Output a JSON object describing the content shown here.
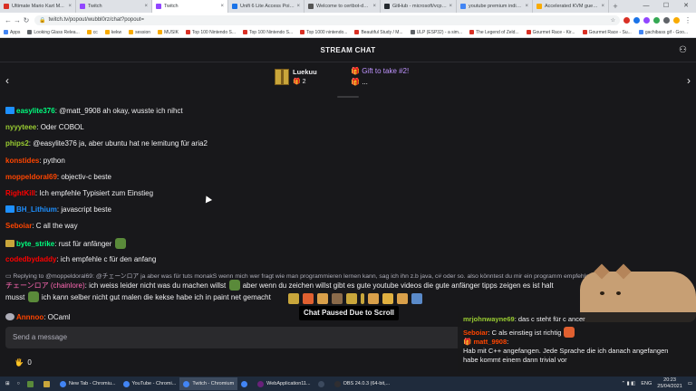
{
  "browser": {
    "tabs": [
      {
        "label": "Ultimate Mario Kart M...",
        "color": "#d93025",
        "active": false
      },
      {
        "label": "Twitch",
        "color": "#9146ff",
        "active": false
      },
      {
        "label": "Twitch",
        "color": "#9146ff",
        "active": true
      },
      {
        "label": "Unifi 6 Lite Access Point -...",
        "color": "#1a73e8",
        "active": false
      },
      {
        "label": "Welcome to certbot-dns-cl...",
        "color": "#555555",
        "active": false
      },
      {
        "label": "GitHub - microsoft/vcpkg: C...",
        "color": "#24292e",
        "active": false
      },
      {
        "label": "youtube premium india - G...",
        "color": "#4285f4",
        "active": false
      },
      {
        "label": "Accelerated KVM guests o...",
        "color": "#f9ab00",
        "active": false
      }
    ],
    "url": "twitch.tv/popout/wubbl0rz/chat?popout=",
    "bookmarks": [
      {
        "label": "Apps",
        "color": "#4285f4"
      },
      {
        "label": "Looking Glass Relea...",
        "color": "#5f6368"
      },
      {
        "label": "cc",
        "color": "#f9ab00"
      },
      {
        "label": "kekw",
        "color": "#f9ab00"
      },
      {
        "label": "session",
        "color": "#f9ab00"
      },
      {
        "label": "MUSIK",
        "color": "#f9ab00"
      },
      {
        "label": "Top 100 Nintendo S...",
        "color": "#d93025"
      },
      {
        "label": "Top 100 Nintendo S...",
        "color": "#d93025"
      },
      {
        "label": "Top 1000 nintendo...",
        "color": "#d93025"
      },
      {
        "label": "Beautiful Study / M...",
        "color": "#d93025"
      },
      {
        "label": "ULP (ESP32) - a sim...",
        "color": "#5f6368"
      },
      {
        "label": "The Legend of Zeld...",
        "color": "#d93025"
      },
      {
        "label": "Gourmet Race - Kir...",
        "color": "#d93025"
      },
      {
        "label": "Gourmet Race - Su...",
        "color": "#d93025"
      },
      {
        "label": "gachibass gif - Goo...",
        "color": "#4285f4"
      }
    ]
  },
  "header": {
    "title": "STREAM CHAT"
  },
  "gifts": {
    "left_name": "Luekuu",
    "left_count": "2",
    "right_title": "Gift to take #2!",
    "right_detail": "..."
  },
  "messages": [
    {
      "user": "easylite376",
      "color": "#00ff7f",
      "badge": "#1e90ff",
      "text": ": @matt_9908 ah okay, wusste ich nihct"
    },
    {
      "user": "nyyyteee",
      "color": "#9acd32",
      "badge": "",
      "text": ": Oder COBOL"
    },
    {
      "user": "phips2",
      "color": "#9acd32",
      "badge": "",
      "text": ": @easylite376 ja, aber ubuntu hat ne lemitung für aria2"
    },
    {
      "user": "konstides",
      "color": "#ff4500",
      "badge": "",
      "text": ": python"
    },
    {
      "user": "moppeldoral69",
      "color": "#ff4500",
      "badge": "",
      "text": ": objectiv-c beste"
    },
    {
      "user": "RightKill",
      "color": "#ff0000",
      "badge": "",
      "text": ": Ich empfehle Typisiert zum Einstieg"
    },
    {
      "user": "BH_Lithium",
      "color": "#1e90ff",
      "badge": "#1e90ff",
      "text": ": javascript beste"
    },
    {
      "user": "Seboiar",
      "color": "#ff4500",
      "badge": "",
      "text": ": C all the way"
    },
    {
      "user": "byte_strike",
      "color": "#00ff7f",
      "badge": "#c9a63b",
      "text": ": rust für anfänger"
    },
    {
      "user": "codedbydaddy",
      "color": "#ff0000",
      "badge": "",
      "text": ": ich empfehle c für den anfang"
    }
  ],
  "reply": {
    "header": "Replying to @moppeldoral69: @チェーンロア ja aber was für tuts monakS wenn mich wer fragt wie man programmieren lernen kann, sag ich ihn z.b java, c# oder so. also könntest du mir ein programm empfehlen mit d...",
    "user": "チェーンロア",
    "user_suffix": "(chainlore)",
    "line1": ": ich weiss leider nicht was du machen willst",
    "line1b": "aber wenn du zeichen willst gibt es gute youtube videos die gute anfänger tipps zeigen es ist halt",
    "line2_start": "musst",
    "line2": "ich kann selber nicht gut malen die kekse habe ich in paint net gemacht"
  },
  "last_message": {
    "user": "Annnoo",
    "text": ": OCaml"
  },
  "paused_label": "Chat Paused Due to Scroll",
  "input_placeholder": "Send a message",
  "points": "0",
  "overlay": {
    "m1_user": "mrjohnwayne69",
    "m1_text": ": das c steht für c ancer",
    "m2_user": "Seboiar",
    "m2_text": ": C als einstieg ist richtig",
    "m3_user": "matt_9908",
    "m3_text": ":",
    "m3_line1": "Hab mit C++ angefangen. Jede Sprache die ich danach angefangen",
    "m3_line2": "habe kommt einem dann trivial vor"
  },
  "taskbar": {
    "items": [
      {
        "label": "New Tab - Chromiu...",
        "color": "#4285f4",
        "active": false
      },
      {
        "label": "YouTube - Chromi...",
        "color": "#4285f4",
        "active": false
      },
      {
        "label": "Twitch - Chromium",
        "color": "#4285f4",
        "active": true
      },
      {
        "label": "",
        "color": "#4285f4",
        "active": false
      },
      {
        "label": "WebApplication11...",
        "color": "#68217a",
        "active": false
      },
      {
        "label": "",
        "color": "#3c4a5e",
        "active": false
      },
      {
        "label": "OBS 24.0.3 (64-bit,...",
        "color": "#302e31",
        "active": false
      }
    ],
    "lang": "ENG",
    "time": "20:23",
    "date": "25/04/2021"
  }
}
